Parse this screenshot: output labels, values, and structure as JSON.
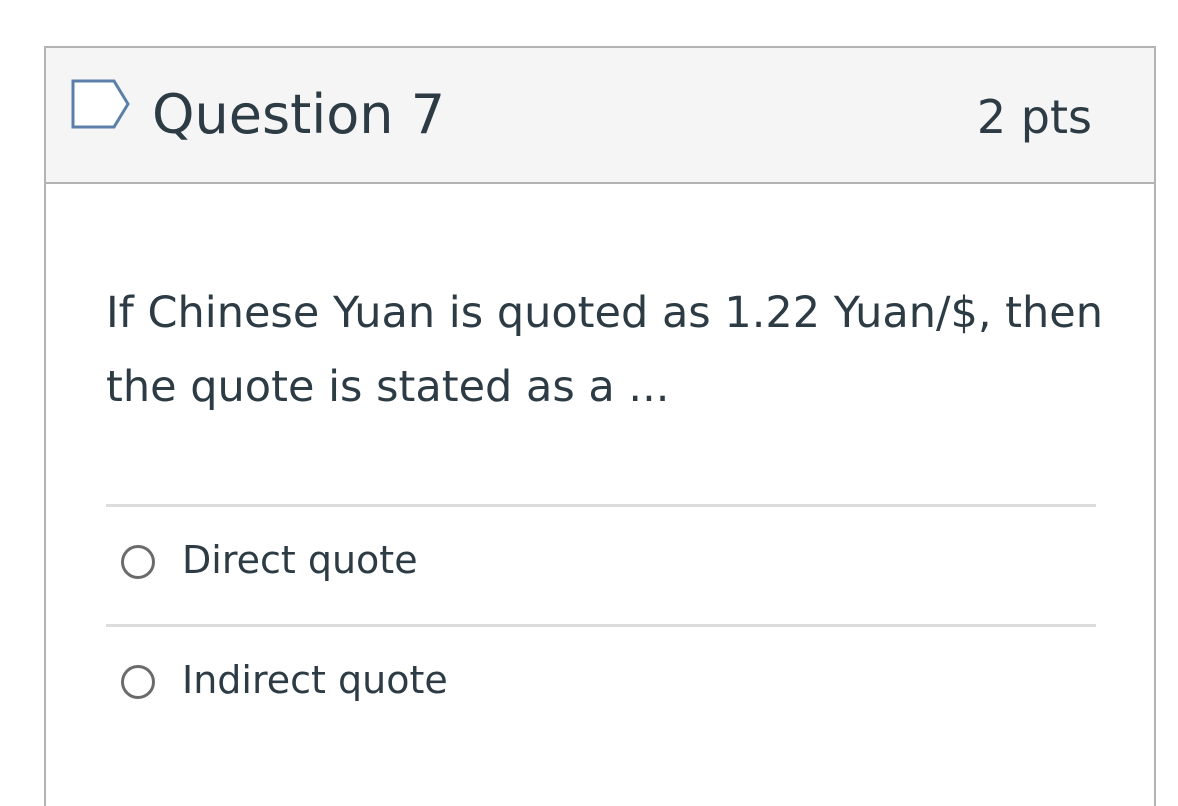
{
  "question": {
    "title": "Question 7",
    "points": "2 pts",
    "text": "If Chinese Yuan is quoted as 1.22 Yuan/$, then the quote is stated as a ...",
    "flag_icon": "flag-outline-icon",
    "answers": [
      {
        "label": "Direct quote",
        "selected": false
      },
      {
        "label": "Indirect quote",
        "selected": false
      }
    ]
  },
  "colors": {
    "header_background": "#f5f5f5",
    "border": "#b3b3b3",
    "divider": "#dddddd",
    "text": "#2d3b45",
    "flag_stroke": "#5a7fa8"
  }
}
